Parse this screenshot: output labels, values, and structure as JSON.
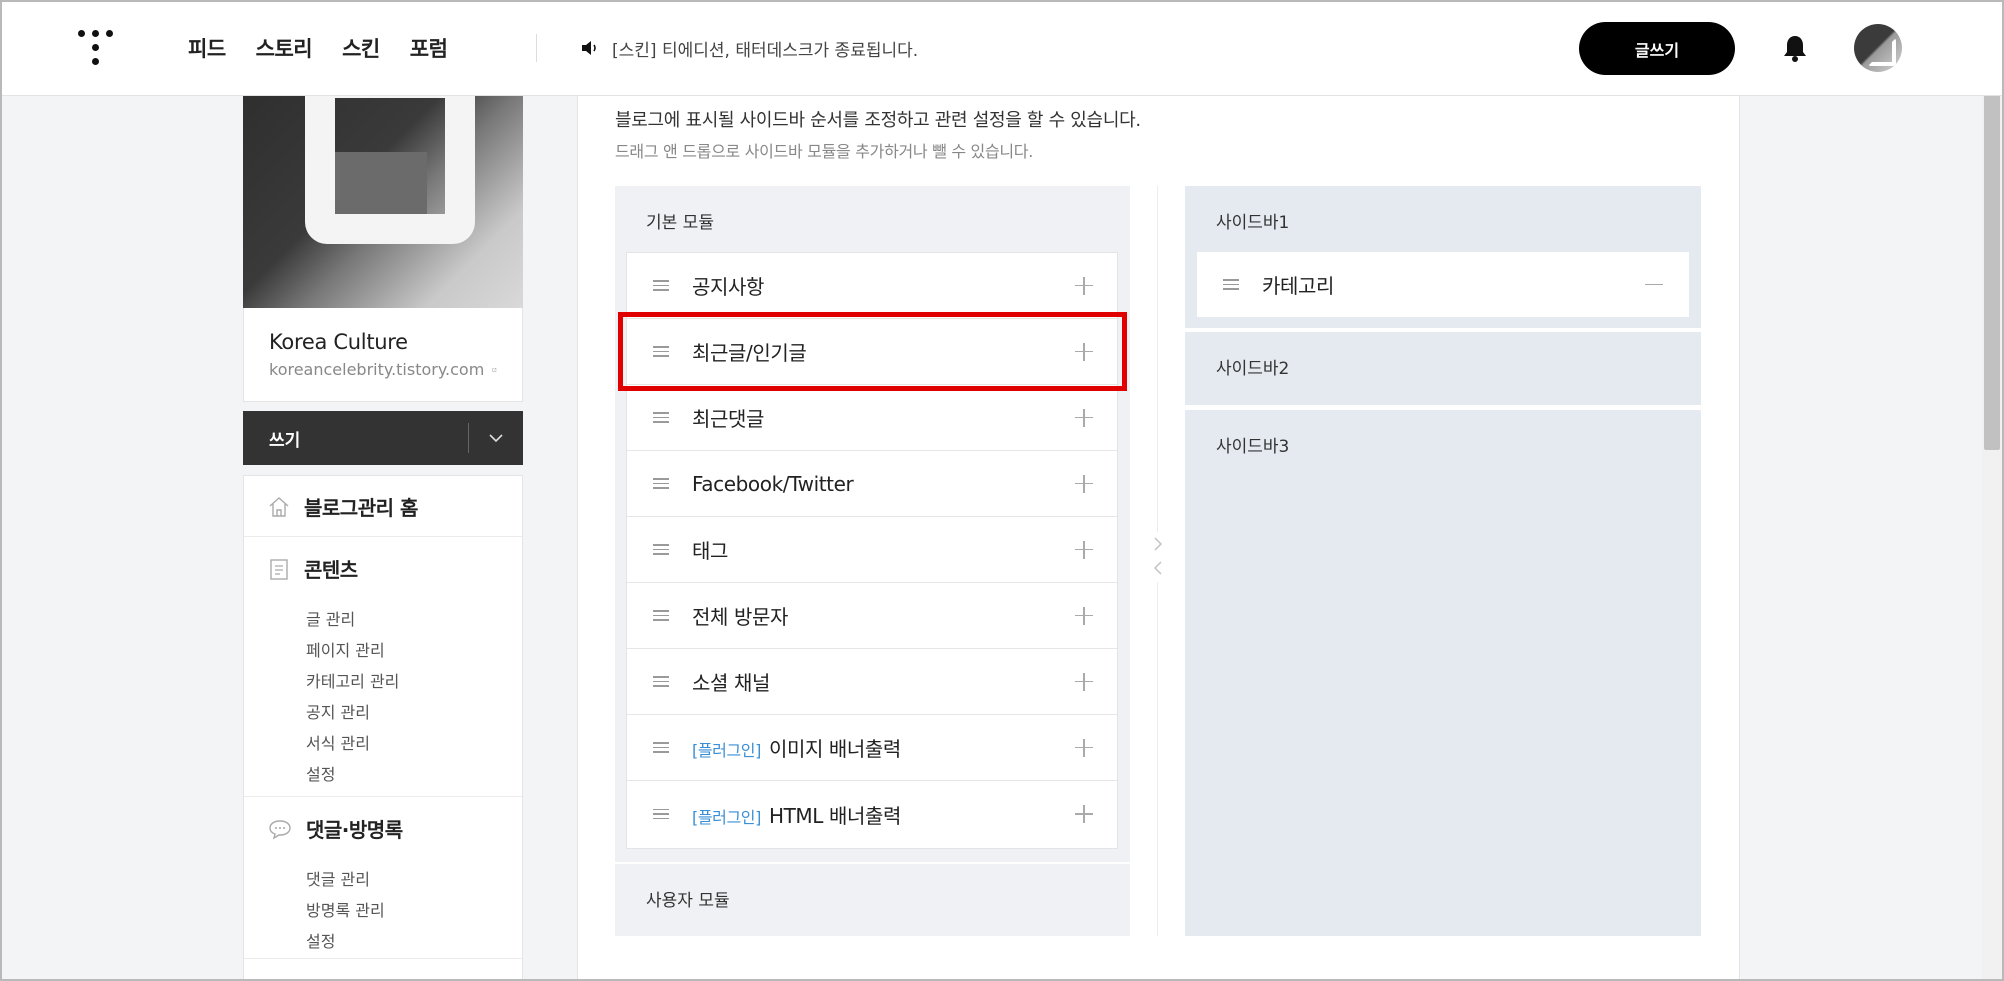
{
  "topbar": {
    "nav": [
      "피드",
      "스토리",
      "스킨",
      "포럼"
    ],
    "notice": "[스킨] 티에디션, 태터데스크가 종료됩니다.",
    "write_button": "글쓰기"
  },
  "profile": {
    "blog_name": "Korea Culture",
    "blog_url": "koreancelebrity.tistory.com"
  },
  "write_menu": {
    "label": "쓰기"
  },
  "menu": {
    "home": "블로그관리 홈",
    "contents": {
      "title": "콘텐츠",
      "items": [
        "글 관리",
        "페이지 관리",
        "카테고리 관리",
        "공지 관리",
        "서식 관리",
        "설정"
      ]
    },
    "comments": {
      "title": "댓글·방명록",
      "items": [
        "댓글 관리",
        "방명록 관리",
        "설정"
      ]
    }
  },
  "main": {
    "description": "블로그에 표시될 사이드바 순서를 조정하고 관련 설정을 할 수 있습니다.",
    "sub_description": "드래그 앤 드롭으로 사이드바 모듈을 추가하거나 뺄 수 있습니다.",
    "basic_modules": {
      "title": "기본 모듈",
      "items": [
        {
          "tag": "",
          "label": "공지사항"
        },
        {
          "tag": "",
          "label": "최근글/인기글"
        },
        {
          "tag": "",
          "label": "최근댓글"
        },
        {
          "tag": "",
          "label": "Facebook/Twitter"
        },
        {
          "tag": "",
          "label": "태그"
        },
        {
          "tag": "",
          "label": "전체 방문자"
        },
        {
          "tag": "",
          "label": "소셜 채널"
        },
        {
          "tag": "[플러그인]",
          "label": "이미지 배너출력"
        },
        {
          "tag": "[플러그인]",
          "label": "HTML 배너출력"
        }
      ]
    },
    "user_modules": {
      "title": "사용자 모듈"
    },
    "sidebars": [
      {
        "title": "사이드바1",
        "modules": [
          "카테고리"
        ]
      },
      {
        "title": "사이드바2",
        "modules": []
      },
      {
        "title": "사이드바3",
        "modules": []
      }
    ]
  },
  "colors": {
    "highlight": "#e00000",
    "plugin_tag": "#3a8fd6",
    "sidebar_panel": "#e5eaf0",
    "module_panel": "#eff1f4"
  }
}
